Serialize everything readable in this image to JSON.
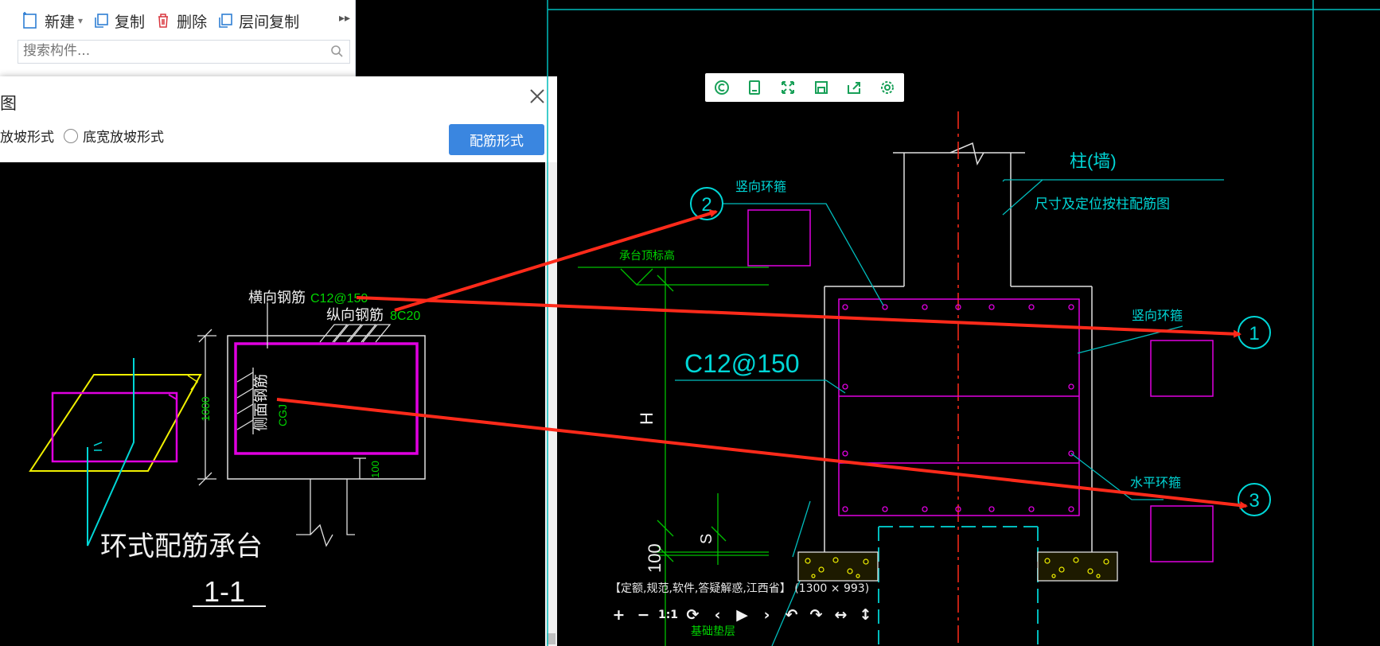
{
  "toolbar": {
    "new_label": "新建",
    "copy_label": "复制",
    "delete_label": "删除",
    "floor_copy_label": "层间复制"
  },
  "search": {
    "placeholder": "搜索构件..."
  },
  "dialog": {
    "title": "图",
    "radio_option_1": "角度放坡形式",
    "radio_option_2": "底宽放坡形式",
    "rebar_button": "配筋形式",
    "drawing": {
      "label_transverse": "横向钢筋",
      "value_transverse": "C12@150",
      "label_longitudinal": "纵向钢筋",
      "value_longitudinal": "8C20",
      "label_side": "侧面钢筋",
      "value_side": "CGJ",
      "dim_height": "1000",
      "dim_small": "100",
      "title": "环式配筋承台",
      "section": "1-1"
    }
  },
  "cad": {
    "col_label": "柱(墙)",
    "col_note": "尺寸及定位按柱配筋图",
    "vertical_hoop_1": "竖向环箍",
    "vertical_hoop_2": "竖向环箍",
    "horizontal_hoop": "水平环箍",
    "cap_top_elev": "承台顶标高",
    "bottom_layer": "基础垫层",
    "rebar_spec": "C12@150",
    "dim_h": "H",
    "dim_s": "S",
    "dim_100": "100",
    "marker_1": "1",
    "marker_2": "2",
    "marker_3": "3"
  },
  "viewer": {
    "caption": "【定额,规范,软件,答疑解惑,江西省】 (1300 × 993)",
    "nav": [
      "+",
      "−",
      "1:1",
      "⟳",
      "‹",
      "▶",
      "›",
      "↶",
      "↷",
      "↔",
      "↕"
    ]
  },
  "colors": {
    "cyan": "#00d6d6",
    "magenta": "#e000e0",
    "green": "#00d400",
    "yellow": "#f0f000",
    "red": "#ff2a1a",
    "button_blue": "#3a86e0"
  }
}
